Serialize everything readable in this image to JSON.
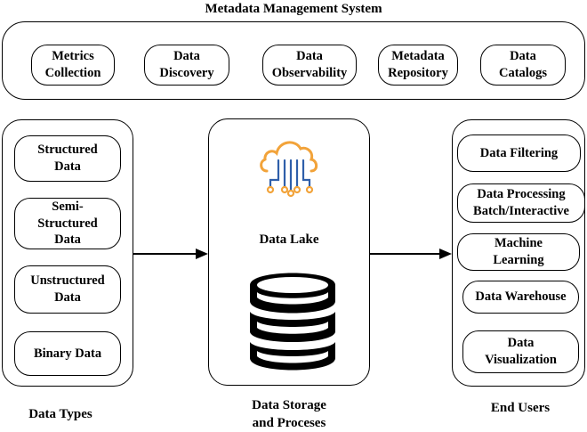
{
  "header": {
    "title": "Metadata Management System"
  },
  "metadata": {
    "items": [
      {
        "label": "Metrics\nCollection"
      },
      {
        "label": "Data\nDiscovery"
      },
      {
        "label": "Data\nObservability"
      },
      {
        "label": "Metadata\nRepository"
      },
      {
        "label": "Data\nCatalogs"
      }
    ]
  },
  "data_types": {
    "caption": "Data Types",
    "items": [
      {
        "label": "Structured\nData"
      },
      {
        "label": "Semi-\nStructured\nData"
      },
      {
        "label": "Unstructured\nData"
      },
      {
        "label": "Binary Data"
      }
    ]
  },
  "storage": {
    "lake_label": "Data Lake",
    "caption": "Data Storage\nand Proceses",
    "cloud_icon": "cloud-network-icon",
    "db_icon": "database-icon",
    "icon_color": "#F2A33A"
  },
  "end_users": {
    "caption": "End Users",
    "items": [
      {
        "label": "Data Filtering"
      },
      {
        "label": "Data Processing\nBatch/Interactive"
      },
      {
        "label": "Machine\nLearning"
      },
      {
        "label": "Data Warehouse"
      },
      {
        "label": "Data\nVisualization"
      }
    ]
  }
}
